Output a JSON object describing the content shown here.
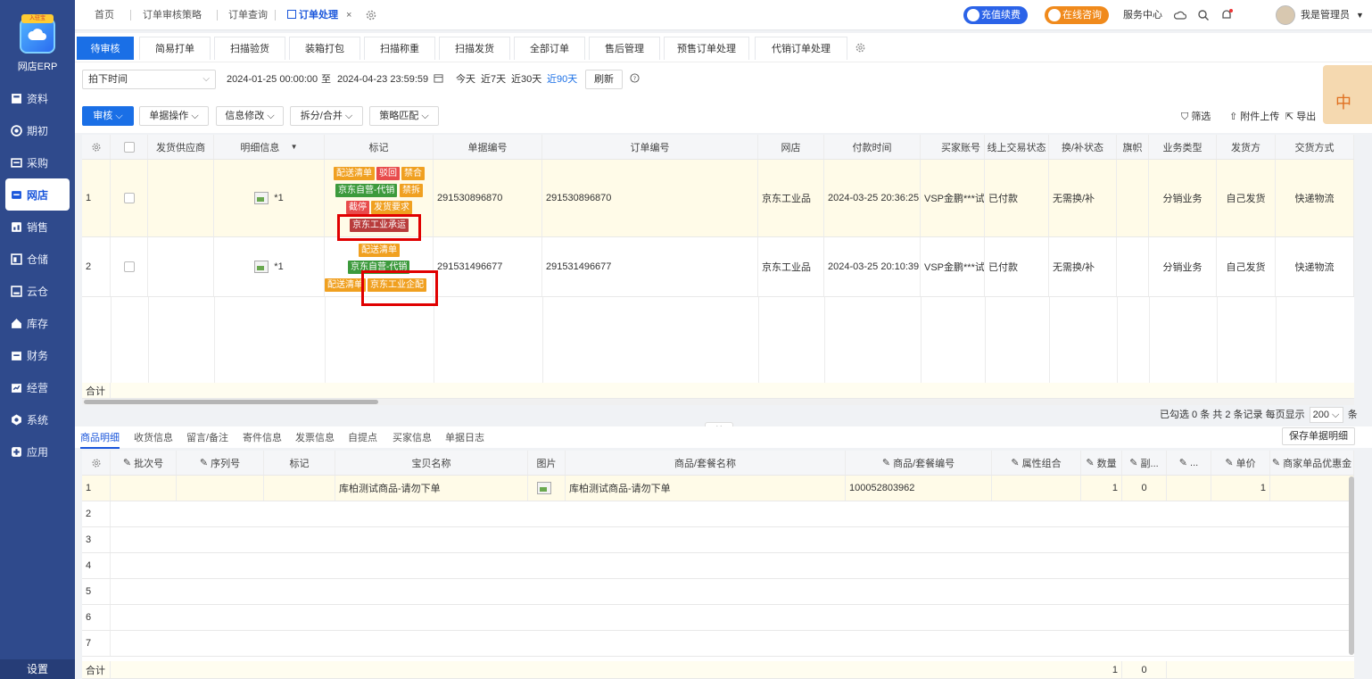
{
  "sidebar": {
    "logo_badge": "入驻宝",
    "logo_text": "网店ERP",
    "items": [
      {
        "label": "资料",
        "icon": "data-icon"
      },
      {
        "label": "期初",
        "icon": "opening-icon"
      },
      {
        "label": "采购",
        "icon": "purchase-icon"
      },
      {
        "label": "网店",
        "icon": "shop-icon",
        "active": true
      },
      {
        "label": "销售",
        "icon": "sales-icon"
      },
      {
        "label": "仓储",
        "icon": "warehouse-icon"
      },
      {
        "label": "云仓",
        "icon": "cloud-warehouse-icon"
      },
      {
        "label": "库存",
        "icon": "inventory-icon"
      },
      {
        "label": "财务",
        "icon": "finance-icon"
      },
      {
        "label": "经营",
        "icon": "business-icon"
      },
      {
        "label": "系统",
        "icon": "system-icon"
      },
      {
        "label": "应用",
        "icon": "apps-icon"
      }
    ],
    "settings": "设置"
  },
  "topbar": {
    "tabs": [
      "首页",
      "订单审核策略",
      "订单查询",
      "订单处理"
    ],
    "close": "×",
    "recharge": "充值续费",
    "consult": "在线咨询",
    "service": "服务中心",
    "user": "我是管理员"
  },
  "subtabs": [
    "待审核",
    "简易打单",
    "扫描验货",
    "装箱打包",
    "扫描称重",
    "扫描发货",
    "全部订单",
    "售后管理",
    "预售订单处理",
    "代销订单处理"
  ],
  "filter": {
    "time_type": "拍下时间",
    "date_start": "2024-01-25 00:00:00",
    "date_to": "至",
    "date_end": "2024-04-23 23:59:59",
    "today": "今天",
    "d7": "近7天",
    "d30": "近30天",
    "d90": "近90天",
    "refresh": "刷新"
  },
  "toolbar": {
    "audit": "审核",
    "single_op": "单据操作",
    "info_edit": "信息修改",
    "split_merge": "拆分/合并",
    "strategy": "策略匹配",
    "filter": "筛选",
    "attach": "附件上传",
    "export": "导出"
  },
  "grid": {
    "columns": [
      "发货供应商",
      "明细信息",
      "标记",
      "单据编号",
      "订单编号",
      "网店",
      "付款时间",
      "买家账号",
      "线上交易状态",
      "换/补状态",
      "旗帜",
      "业务类型",
      "发货方",
      "交货方式"
    ],
    "rows": [
      {
        "no": "1",
        "detail": "*1",
        "tags": [
          "配送清单",
          "驳回",
          "禁合",
          "京东自营-代销",
          "禁拆",
          "截停",
          "发货要求",
          "京东工业承运"
        ],
        "bill_no": "291530896870",
        "order_no": "291530896870",
        "shop": "京东工业品",
        "pay_time": "2024-03-25 20:36:25",
        "buyer": "VSP金鹏***试",
        "trade_status": "已付款",
        "exchange": "无需换/补",
        "biz_type": "分销业务",
        "shipper": "自己发货",
        "delivery": "快递物流"
      },
      {
        "no": "2",
        "detail": "*1",
        "tags": [
          "配送清单",
          "京东自营-代销",
          "配送清单",
          "京东工业企配"
        ],
        "bill_no": "291531496677",
        "order_no": "291531496677",
        "shop": "京东工业品",
        "pay_time": "2024-03-25 20:10:39",
        "buyer": "VSP金鹏***试",
        "trade_status": "已付款",
        "exchange": "无需换/补",
        "biz_type": "分销业务",
        "shipper": "自己发货",
        "delivery": "快递物流"
      }
    ],
    "total": "合计"
  },
  "pager": {
    "text1": "已勾选 0 条 共 2 条记录 每页显示",
    "size": "200",
    "text2": "条"
  },
  "bottom_tabs": [
    "商品明细",
    "收货信息",
    "留言/备注",
    "寄件信息",
    "发票信息",
    "自提点",
    "买家信息",
    "单据日志"
  ],
  "save_detail": "保存单据明细",
  "grid2": {
    "columns": [
      "批次号",
      "序列号",
      "标记",
      "宝贝名称",
      "图片",
      "商品/套餐名称",
      "商品/套餐编号",
      "属性组合",
      "数量",
      "副...",
      "...",
      "单价",
      "商家单品优惠金"
    ],
    "row": {
      "name": "库柏测试商品-请勿下单",
      "goods": "库柏测试商品-请勿下单",
      "code": "100052803962",
      "qty": "1",
      "sub": "0",
      "price": "1"
    },
    "row_numbers": [
      "1",
      "2",
      "3",
      "4",
      "5",
      "6",
      "7"
    ],
    "total": "合计",
    "total_qty": "1",
    "total_sub": "0"
  },
  "widget": "中"
}
